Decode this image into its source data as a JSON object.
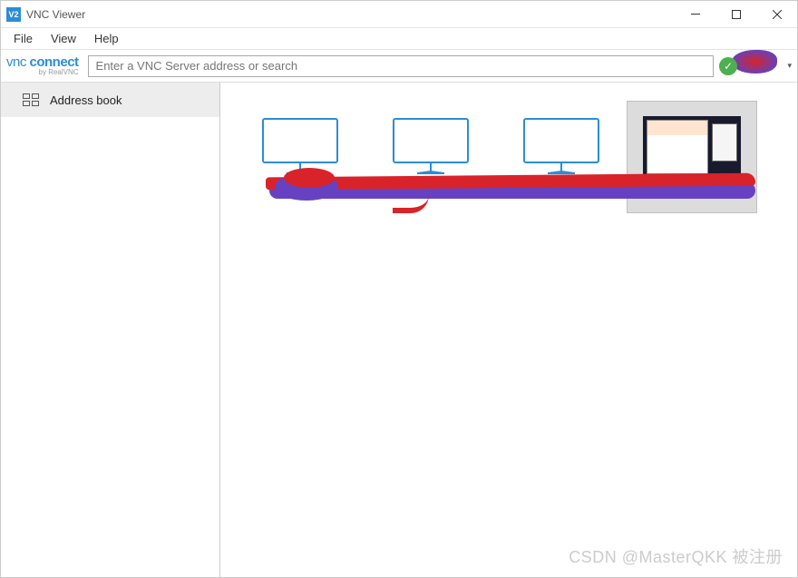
{
  "window": {
    "title": "VNC Viewer",
    "icon_label": "V2"
  },
  "menubar": {
    "items": [
      "File",
      "View",
      "Help"
    ]
  },
  "toolbar": {
    "logo_main_a": "vnc ",
    "logo_main_b": "connect",
    "logo_sub": "by RealVNC",
    "search_placeholder": "Enter a VNC Server address or search"
  },
  "sidebar": {
    "items": [
      {
        "label": "Address book"
      }
    ]
  },
  "connections": [
    {
      "label": "",
      "type": "monitor",
      "selected": false
    },
    {
      "label": "",
      "type": "monitor",
      "selected": false
    },
    {
      "label": "",
      "type": "monitor",
      "selected": false
    },
    {
      "label": "",
      "type": "thumb",
      "selected": true
    }
  ],
  "watermark": "CSDN @MasterQKK 被注册"
}
